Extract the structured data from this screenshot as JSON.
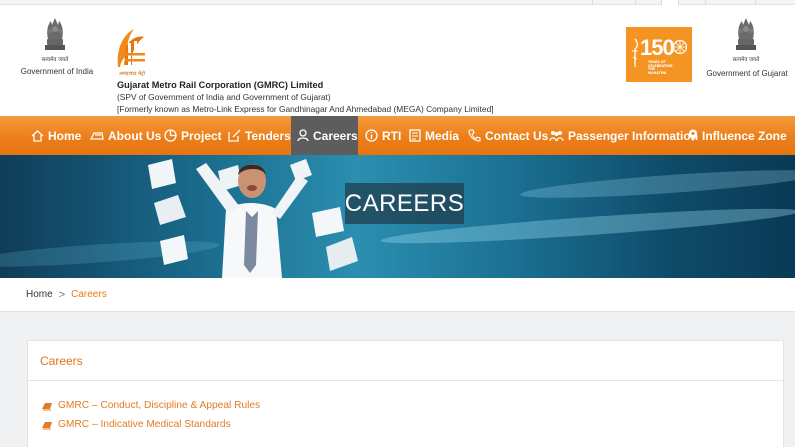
{
  "header": {
    "left_emblem": {
      "motto": "सत्यमेव जयते",
      "caption": "Government of India"
    },
    "logo_hindi": "अमदावाद मेट्रो",
    "org_name": "Gujarat Metro Rail Corporation (GMRC) Limited",
    "org_line1": "(SPV of Government of India and Government of Gujarat)",
    "org_line2": "[Formerly known as Metro-Link Express for Gandhinagar And Ahmedabad (MEGA) Company Limited]",
    "badge": {
      "number": "150",
      "tagline": "YEARS OF CELEBRATING THE MAHATMA"
    },
    "right_emblem": {
      "motto": "सत्यमेव जयते",
      "caption": "Government of Gujarat"
    }
  },
  "nav": {
    "items": [
      {
        "label": "Home",
        "icon": "home-icon"
      },
      {
        "label": "About Us",
        "icon": "train-icon"
      },
      {
        "label": "Project",
        "icon": "pie-chart-icon"
      },
      {
        "label": "Tenders",
        "icon": "edit-icon"
      },
      {
        "label": "Careers",
        "icon": "user-icon",
        "active": true
      },
      {
        "label": "RTI",
        "icon": "info-icon"
      },
      {
        "label": "Media",
        "icon": "media-icon"
      },
      {
        "label": "Contact Us",
        "icon": "phone-icon"
      },
      {
        "label": "Passenger Information",
        "icon": "passengers-icon"
      },
      {
        "label": "Influence Zone",
        "icon": "map-pin-icon"
      }
    ],
    "colors": {
      "bar": "#ec7f1a",
      "active": "#5d5d5d"
    }
  },
  "banner": {
    "title": "CAREERS"
  },
  "breadcrumb": {
    "home": "Home",
    "separator": ">",
    "current": "Careers"
  },
  "careers": {
    "heading": "Careers",
    "links": [
      "GMRC – Conduct, Discipline & Appeal Rules",
      "GMRC – Indicative Medical Standards"
    ]
  },
  "colors": {
    "accent": "#ea7a13",
    "link": "#e27c22"
  }
}
